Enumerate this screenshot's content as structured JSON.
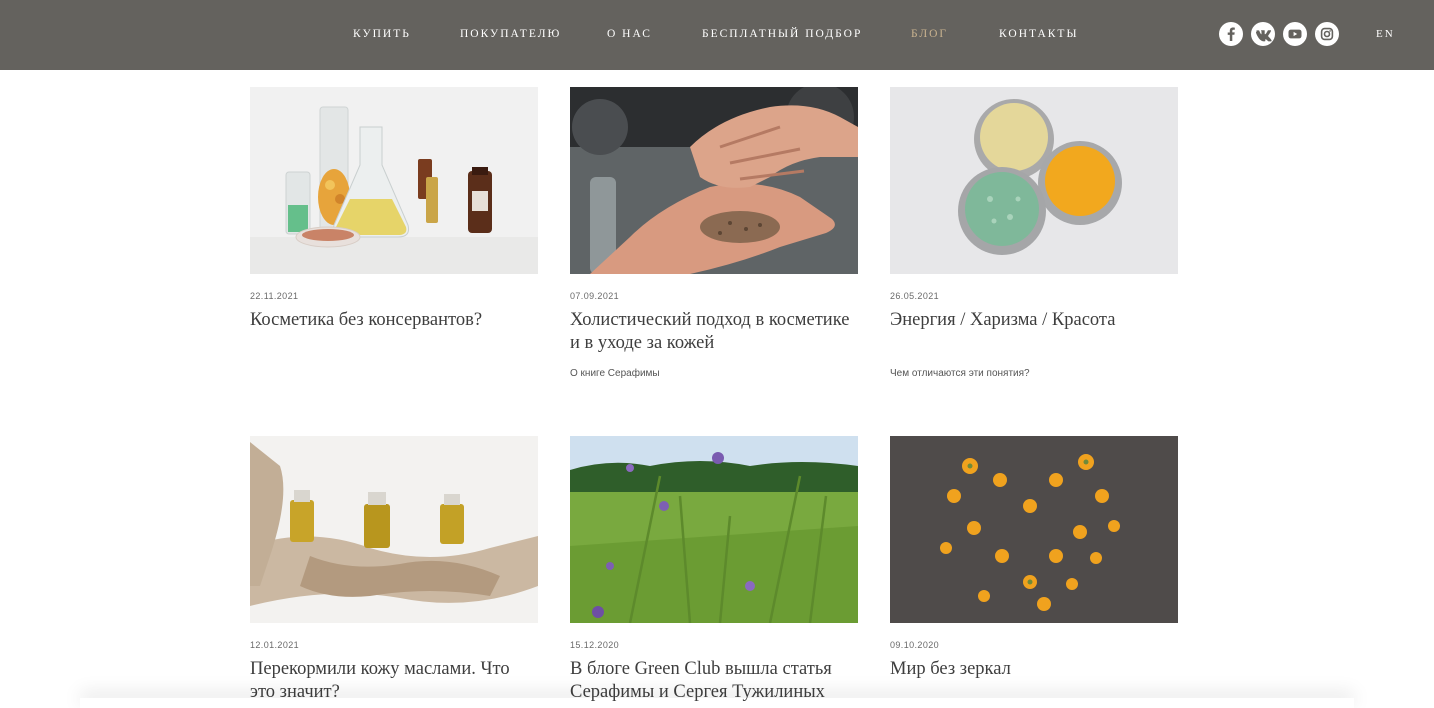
{
  "nav": {
    "items": [
      {
        "label": "КУПИТЬ"
      },
      {
        "label": "ПОКУПАТЕЛЮ"
      },
      {
        "label": "О НАС"
      },
      {
        "label": "БЕСПЛАТНЫЙ ПОДБОР"
      },
      {
        "label": "БЛОГ",
        "active": true
      },
      {
        "label": "КОНТАКТЫ"
      }
    ],
    "social": [
      "facebook-icon",
      "vk-icon",
      "youtube-icon",
      "instagram-icon"
    ],
    "lang": "EN",
    "colors": {
      "header_bg": "#64625e",
      "active": "#c9b28f"
    }
  },
  "posts": [
    {
      "date": "22.11.2021",
      "title": "Косметика без консервантов?",
      "desc": ""
    },
    {
      "date": "07.09.2021",
      "title": "Холистический подход в косметике и в уходе за кожей",
      "desc": "О книге Серафимы"
    },
    {
      "date": "26.05.2021",
      "title": "Энергия / Харизма / Красота",
      "desc": "Чем отличаются эти понятия?"
    },
    {
      "date": "12.01.2021",
      "title": "Перекормили кожу маслами. Что это значит?",
      "desc": ""
    },
    {
      "date": "15.12.2020",
      "title": "В блоге Green Club вышла статья Серафимы и Сергея Тужилиных",
      "desc": ""
    },
    {
      "date": "09.10.2020",
      "title": "Мир без зеркал",
      "desc": ""
    }
  ]
}
